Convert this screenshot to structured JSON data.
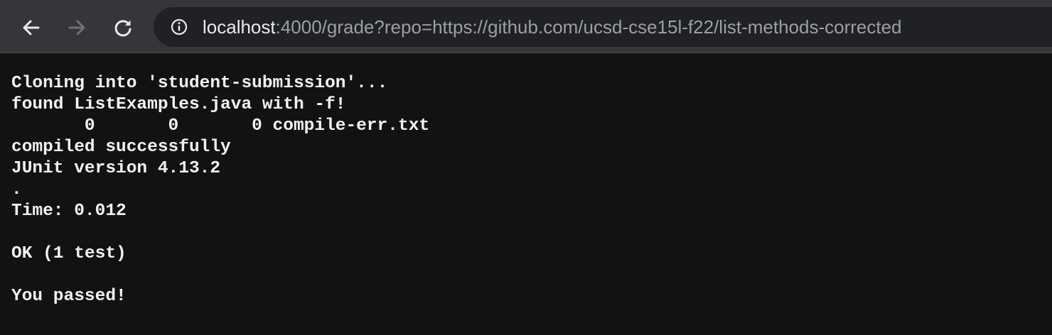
{
  "browser": {
    "url_host": "localhost",
    "url_rest": ":4000/grade?repo=https://github.com/ucsd-cse15l-f22/list-methods-corrected",
    "icons": {
      "back": "arrow-left-icon",
      "forward": "arrow-right-icon",
      "reload": "reload-icon",
      "site_info": "info-icon"
    }
  },
  "page": {
    "output_text": "Cloning into 'student-submission'...\nfound ListExamples.java with -f!\n       0       0       0 compile-err.txt\ncompiled successfully\nJUnit version 4.13.2\n.\nTime: 0.012\n\nOK (1 test)\n\nYou passed!"
  },
  "colors": {
    "toolbar_bg": "#35363a",
    "omnibox_bg": "#202124",
    "page_bg": "#121212",
    "text": "#f2f2f2",
    "url_dim": "#9aa0a6",
    "url_host": "#e8eaed"
  }
}
